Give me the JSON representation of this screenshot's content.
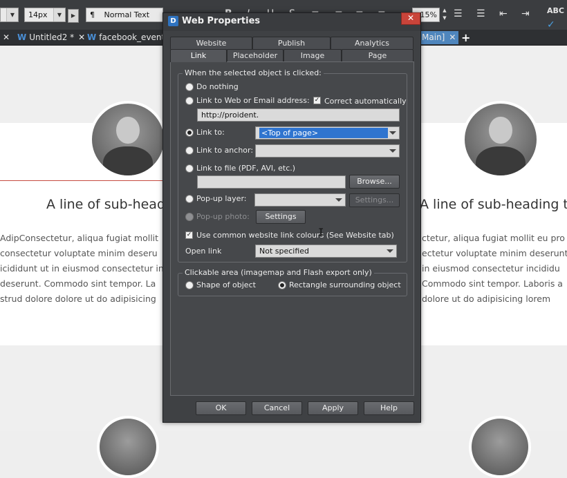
{
  "toolbar": {
    "font_size": "14px",
    "paragraph_style": "Normal Text",
    "paragraph_mark": "¶",
    "format_icons": [
      "B",
      "I",
      "U",
      "S"
    ],
    "zoom_value": "15%",
    "spell_label": "ABC"
  },
  "doc_tabs": [
    {
      "name": "Untitled2 *"
    },
    {
      "name": "facebook_eventcc"
    },
    {
      "name": "Main]"
    }
  ],
  "page": {
    "subheading_left": "A line of sub-head",
    "subheading_right": "A line of sub-heading te",
    "para_left": [
      "AdipConsectetur, aliqua fugiat mollit",
      "consectetur voluptate minim deseru",
      "icididunt ut in eiusmod consectetur in",
      "deserunt. Commodo sint tempor. La",
      "strud dolore dolore ut do adipisicing"
    ],
    "para_right": [
      "ctetur, aliqua fugiat mollit eu pro",
      "ectetur voluptate minim deserunt offic",
      "in eiusmod consectetur incididu",
      "Commodo sint tempor. Laboris a",
      "dolore ut do adipisicing lorem"
    ]
  },
  "dialog": {
    "logo": "D",
    "title": "Web Properties",
    "close": "✕",
    "tabs_back": [
      "Website",
      "Publish",
      "Analytics"
    ],
    "tabs_front": [
      "Link",
      "Placeholder",
      "Image",
      "Page"
    ],
    "group_click_label": "When the selected object is clicked:",
    "do_nothing": "Do nothing",
    "link_web": "Link to Web or Email address:",
    "correct_auto": "Correct automatically",
    "url_value": "http://proident.",
    "link_to": "Link to:",
    "link_to_value": "<Top of page>",
    "link_anchor": "Link to anchor:",
    "link_file": "Link to file (PDF, AVI, etc.)",
    "browse": "Browse...",
    "popup_layer": "Pop-up layer:",
    "settings_dim": "Settings...",
    "popup_photo": "Pop-up photo:",
    "settings": "Settings",
    "use_common": "Use common website link colours (See Website tab)",
    "open_link": "Open link",
    "open_link_value": "Not specified",
    "group_area_label": "Clickable area (imagemap and Flash export only)",
    "shape_of_object": "Shape of object",
    "rectangle": "Rectangle surrounding object",
    "ok": "OK",
    "cancel": "Cancel",
    "apply": "Apply",
    "help": "Help"
  }
}
